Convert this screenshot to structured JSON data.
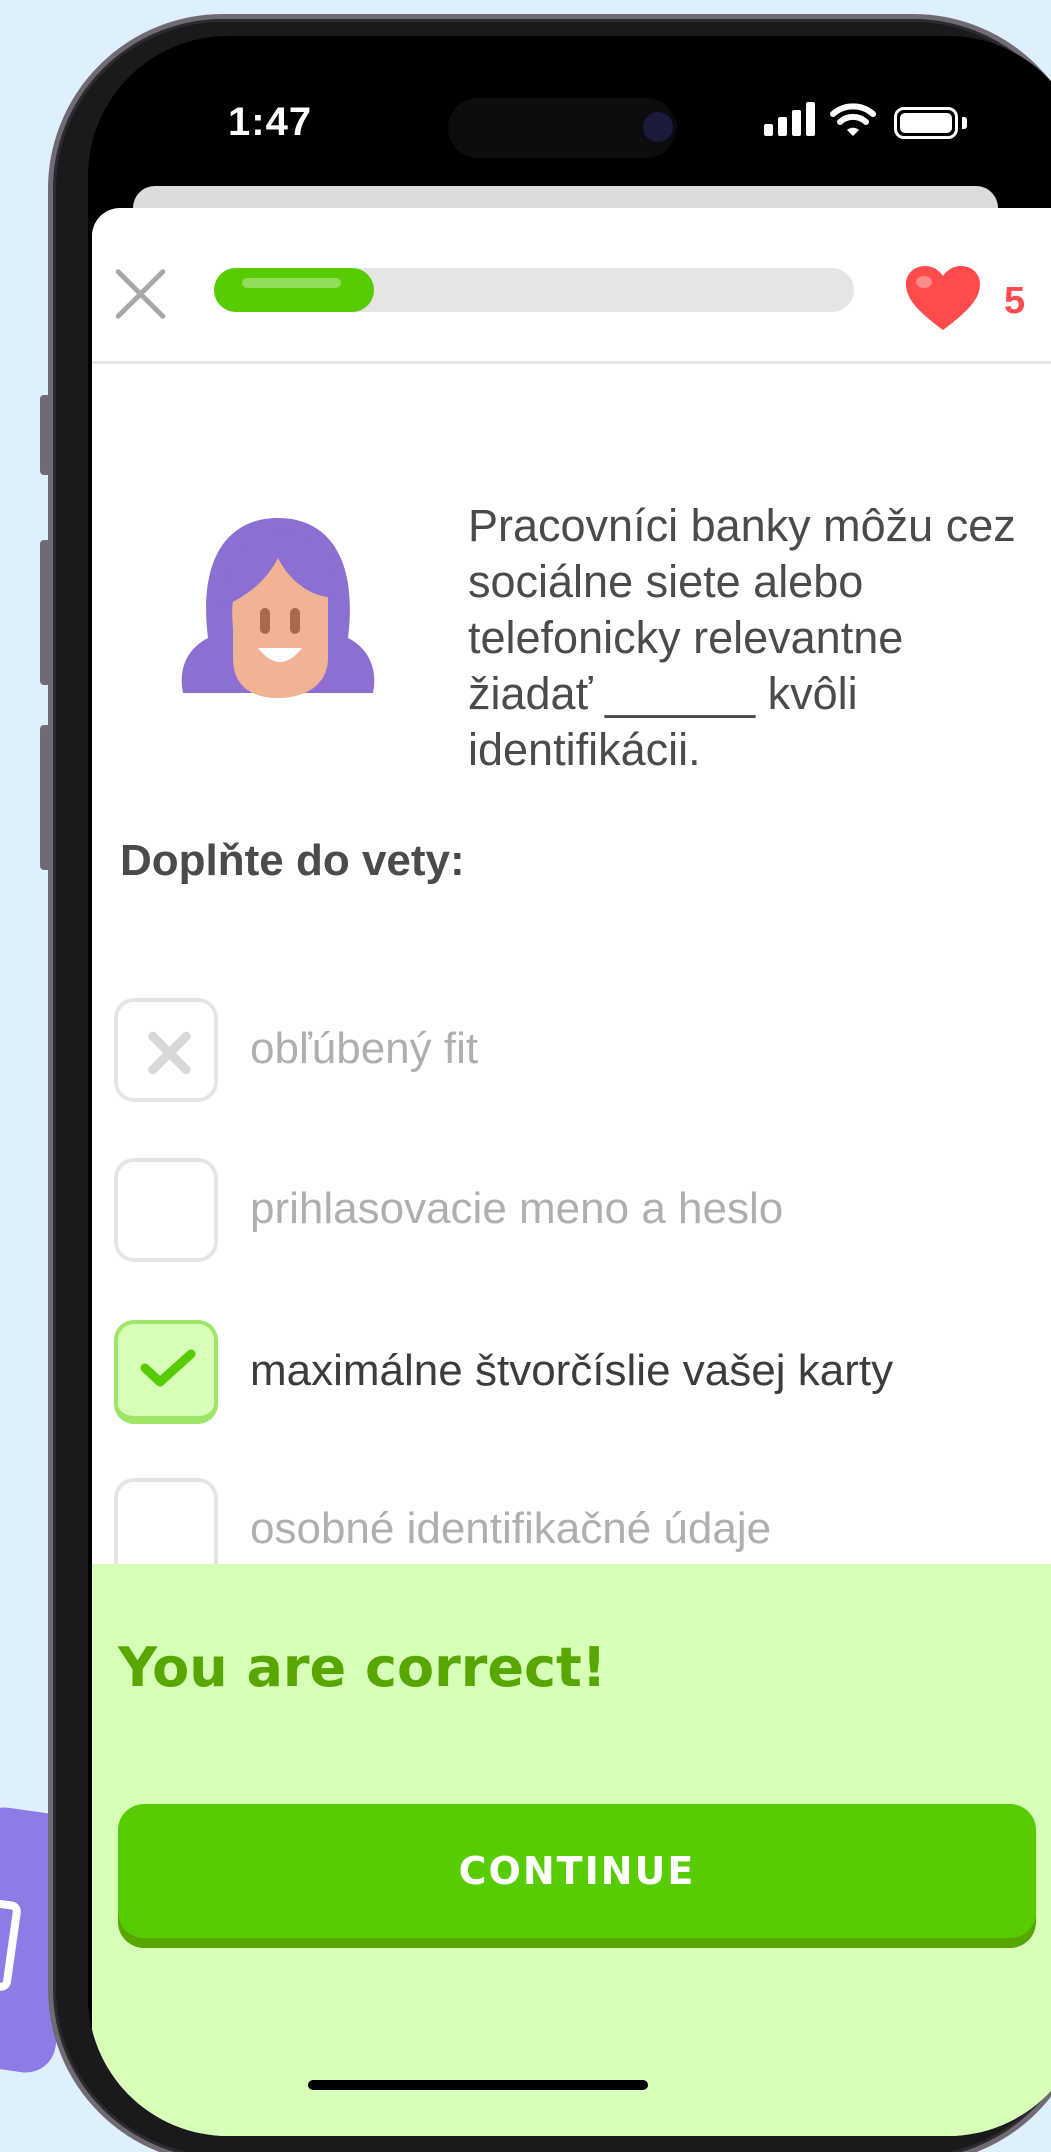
{
  "status_bar": {
    "time": "1:47"
  },
  "lesson": {
    "progress_fraction": 0.25,
    "hearts": "5"
  },
  "prompt": {
    "text": "Pracovníci banky môžu cez sociálne siete alebo telefonicky relevantne žiadať ______ kvôli identifikácii."
  },
  "instruction": "Doplňte do vety:",
  "options": [
    {
      "label": "obľúbený fit",
      "state": "incorrect"
    },
    {
      "label": "prihlasovacie meno a heslo",
      "state": "unselected"
    },
    {
      "label": "maximálne štvorčíslie vašej karty",
      "state": "correct"
    },
    {
      "label": "osobné identifikačné údaje",
      "state": "unselected"
    }
  ],
  "feedback": {
    "title": "You are correct!",
    "continue_label": "CONTINUE"
  },
  "colors": {
    "accent_green": "#58cc02",
    "feedback_bg": "#d7ffb8",
    "heart_red": "#ff4b4b",
    "character_hair": "#8d6fd1"
  }
}
